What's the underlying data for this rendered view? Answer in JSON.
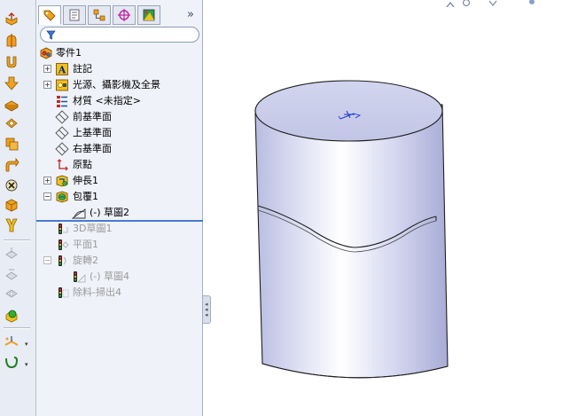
{
  "feature_tree": {
    "part": "零件1",
    "items": [
      {
        "label": "註記",
        "expandable": true,
        "icon": "annotations-icon",
        "suppressed": false
      },
      {
        "label": "光源、攝影機及全景",
        "expandable": true,
        "icon": "lights-cameras-icon",
        "suppressed": false
      },
      {
        "label": "材質 <未指定>",
        "expandable": false,
        "icon": "material-icon",
        "suppressed": false
      },
      {
        "label": "前基準面",
        "expandable": false,
        "icon": "plane-icon",
        "suppressed": false
      },
      {
        "label": "上基準面",
        "expandable": false,
        "icon": "plane-icon",
        "suppressed": false
      },
      {
        "label": "右基準面",
        "expandable": false,
        "icon": "plane-icon",
        "suppressed": false
      },
      {
        "label": "原點",
        "expandable": false,
        "icon": "origin-icon",
        "suppressed": false
      },
      {
        "label": "伸長1",
        "expandable": true,
        "icon": "extrude-icon",
        "suppressed": false
      },
      {
        "label": "包覆1",
        "expandable": true,
        "expanded": true,
        "icon": "wrap-icon",
        "suppressed": false
      },
      {
        "label": "(-) 草圖2",
        "expandable": false,
        "icon": "sketch-icon",
        "suppressed": false,
        "child": true
      },
      {
        "label": "3D草圖1",
        "expandable": false,
        "icon": "sketch3d-icon",
        "suppressed": true
      },
      {
        "label": "平面1",
        "expandable": false,
        "icon": "plane-feature-icon",
        "suppressed": true
      },
      {
        "label": "旋轉2",
        "expandable": true,
        "expanded": true,
        "icon": "revolve-icon",
        "suppressed": true
      },
      {
        "label": "(-) 草圖4",
        "expandable": false,
        "icon": "sketch-icon",
        "suppressed": true,
        "child": true
      },
      {
        "label": "除料-掃出4",
        "expandable": false,
        "icon": "sweep-cut-icon",
        "suppressed": true
      }
    ]
  },
  "panel_tabs": [
    {
      "name": "feature-manager-tab",
      "active": true
    },
    {
      "name": "property-manager-tab",
      "active": false
    },
    {
      "name": "configuration-manager-tab",
      "active": false
    },
    {
      "name": "dimxpert-tab",
      "active": false
    },
    {
      "name": "display-manager-tab",
      "active": false
    }
  ],
  "panel_more": "»",
  "toolbar": [
    "extrude-boss-icon",
    "revolve-boss-icon",
    "sweep-boss-icon",
    "loft-boss-icon",
    "extrude-cut-icon",
    "revolve-cut-icon",
    "sweep-cut-icon",
    "loft-cut-icon",
    "fillet-icon",
    "chamfer-icon",
    "rib-icon",
    "shell-icon",
    "draft-icon",
    "hole-wizard-icon",
    "wrap-icon",
    "dome-icon",
    "reference-geometry-icon",
    "curves-icon"
  ],
  "colors": {
    "accent": "#4a7bd0",
    "part_shade": "#c8cce8",
    "suppressed": "#9a9a9a"
  }
}
